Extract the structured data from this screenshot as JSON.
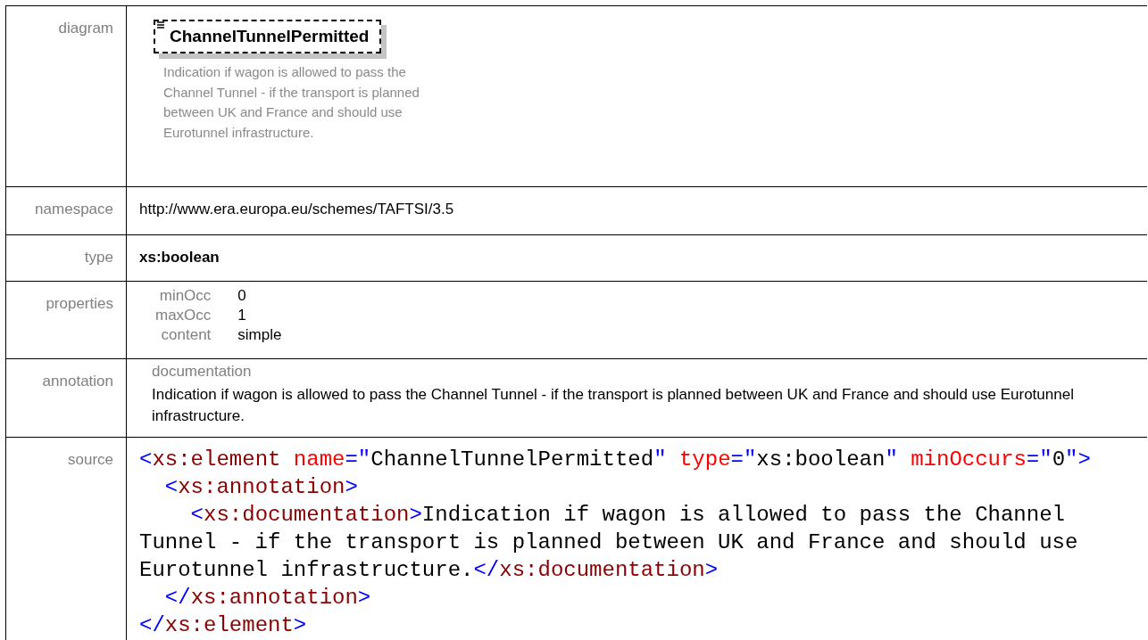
{
  "rows": [
    {
      "label": "diagram",
      "kind": "diagram",
      "element_name": "ChannelTunnelPermitted",
      "description": "Indication if wagon is allowed to pass the Channel Tunnel - if the transport is planned between UK and France and should use Eurotunnel infrastructure."
    },
    {
      "label": "namespace",
      "kind": "text",
      "value": "http://www.era.europa.eu/schemes/TAFTSI/3.5"
    },
    {
      "label": "type",
      "kind": "strong",
      "value": "xs:boolean"
    },
    {
      "label": "properties",
      "kind": "properties",
      "properties": [
        {
          "name": "minOcc",
          "value": "0"
        },
        {
          "name": "maxOcc",
          "value": "1"
        },
        {
          "name": "content",
          "value": "simple"
        }
      ]
    },
    {
      "label": "annotation",
      "kind": "annotation",
      "heading": "documentation",
      "value": "Indication if wagon is allowed to pass the Channel Tunnel - if the transport is planned between UK and France and should use Eurotunnel infrastructure."
    },
    {
      "label": "source",
      "kind": "source",
      "lines": [
        [
          {
            "kind": "punct",
            "text": "<"
          },
          {
            "kind": "tag",
            "text": "xs:element"
          },
          {
            "kind": "attr",
            "text": " name"
          },
          {
            "kind": "punct",
            "text": "=\""
          },
          {
            "kind": "text",
            "text": "ChannelTunnelPermitted"
          },
          {
            "kind": "punct",
            "text": "\""
          },
          {
            "kind": "attr",
            "text": " type"
          },
          {
            "kind": "punct",
            "text": "=\""
          },
          {
            "kind": "text",
            "text": "xs:boolean"
          },
          {
            "kind": "punct",
            "text": "\""
          },
          {
            "kind": "attr",
            "text": " minOccurs"
          },
          {
            "kind": "punct",
            "text": "=\""
          },
          {
            "kind": "text",
            "text": "0"
          },
          {
            "kind": "punct",
            "text": "\">"
          }
        ],
        [
          {
            "kind": "punct",
            "text": "  <"
          },
          {
            "kind": "tag",
            "text": "xs:annotation"
          },
          {
            "kind": "punct",
            "text": ">"
          }
        ],
        [
          {
            "kind": "punct",
            "text": "    <"
          },
          {
            "kind": "tag",
            "text": "xs:documentation"
          },
          {
            "kind": "punct",
            "text": ">"
          },
          {
            "kind": "text",
            "text": "Indication if wagon is allowed to pass the Channel Tunnel - if the transport is planned between UK and France and should use Eurotunnel infrastructure."
          },
          {
            "kind": "punct",
            "text": "</"
          },
          {
            "kind": "tag",
            "text": "xs:documentation"
          },
          {
            "kind": "punct",
            "text": ">"
          }
        ],
        [
          {
            "kind": "punct",
            "text": "  </"
          },
          {
            "kind": "tag",
            "text": "xs:annotation"
          },
          {
            "kind": "punct",
            "text": ">"
          }
        ],
        [
          {
            "kind": "punct",
            "text": "</"
          },
          {
            "kind": "tag",
            "text": "xs:element"
          },
          {
            "kind": "punct",
            "text": ">"
          }
        ]
      ]
    }
  ]
}
